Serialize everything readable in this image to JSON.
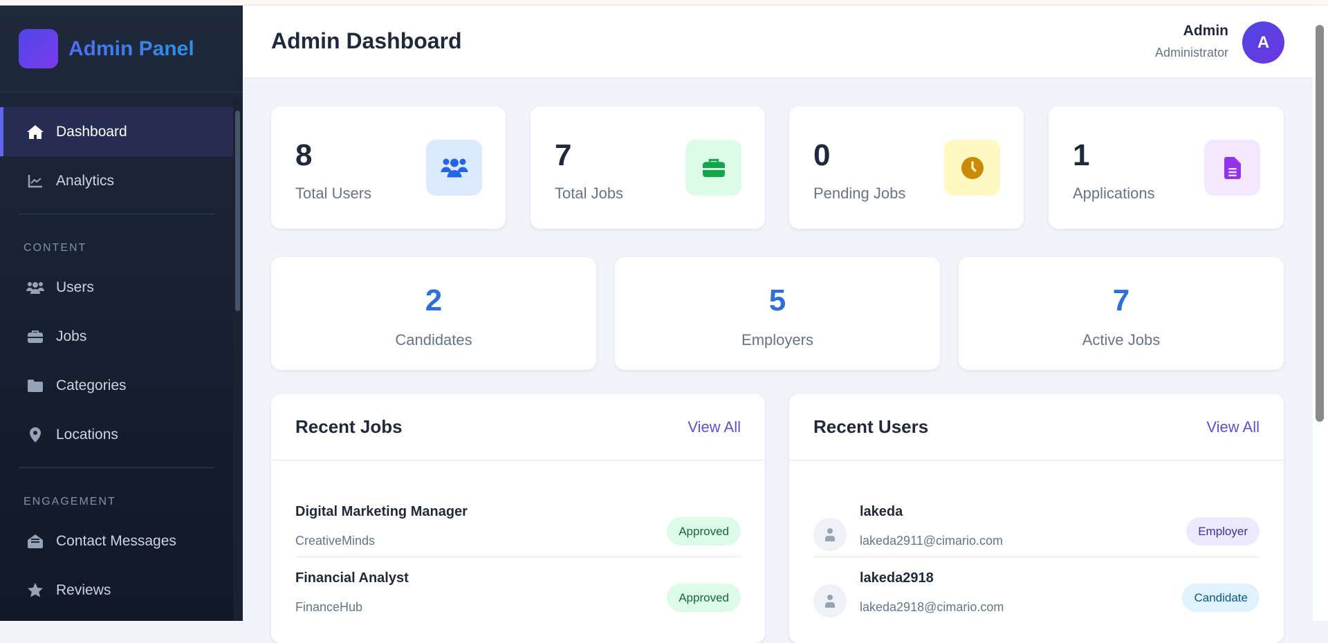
{
  "sidebar": {
    "brand": "Admin Panel",
    "items": [
      {
        "label": "Dashboard",
        "icon": "home-icon",
        "active": true
      },
      {
        "label": "Analytics",
        "icon": "chart-line-icon"
      }
    ],
    "sections": [
      {
        "label": "CONTENT",
        "items": [
          {
            "label": "Users",
            "icon": "users-icon"
          },
          {
            "label": "Jobs",
            "icon": "briefcase-icon"
          },
          {
            "label": "Categories",
            "icon": "folder-icon"
          },
          {
            "label": "Locations",
            "icon": "map-pin-icon"
          }
        ]
      },
      {
        "label": "ENGAGEMENT",
        "items": [
          {
            "label": "Contact Messages",
            "icon": "envelope-open-icon"
          },
          {
            "label": "Reviews",
            "icon": "star-icon"
          }
        ]
      }
    ]
  },
  "header": {
    "title": "Admin Dashboard",
    "user_name": "Admin",
    "user_role": "Administrator",
    "avatar_letter": "A"
  },
  "stats": [
    {
      "value": "8",
      "label": "Total Users",
      "icon": "users-icon",
      "bg": "#dbeafe",
      "color": "#2563eb"
    },
    {
      "value": "7",
      "label": "Total Jobs",
      "icon": "briefcase-icon",
      "bg": "#dcfce7",
      "color": "#16a34a"
    },
    {
      "value": "0",
      "label": "Pending Jobs",
      "icon": "clock-icon",
      "bg": "#fef9c3",
      "color": "#ca8a04"
    },
    {
      "value": "1",
      "label": "Applications",
      "icon": "file-icon",
      "bg": "#f3e8ff",
      "color": "#9333ea"
    }
  ],
  "mini_stats": [
    {
      "value": "2",
      "label": "Candidates"
    },
    {
      "value": "5",
      "label": "Employers"
    },
    {
      "value": "7",
      "label": "Active Jobs"
    }
  ],
  "recent_jobs": {
    "title": "Recent Jobs",
    "view_all": "View All",
    "items": [
      {
        "title": "Digital Marketing Manager",
        "company": "CreativeMinds",
        "status": "Approved"
      },
      {
        "title": "Financial Analyst",
        "company": "FinanceHub",
        "status": "Approved"
      }
    ]
  },
  "recent_users": {
    "title": "Recent Users",
    "view_all": "View All",
    "items": [
      {
        "name": "lakeda",
        "email": "lakeda2911@cimario.com",
        "role": "Employer"
      },
      {
        "name": "lakeda2918",
        "email": "lakeda2918@cimario.com",
        "role": "Candidate"
      }
    ]
  }
}
